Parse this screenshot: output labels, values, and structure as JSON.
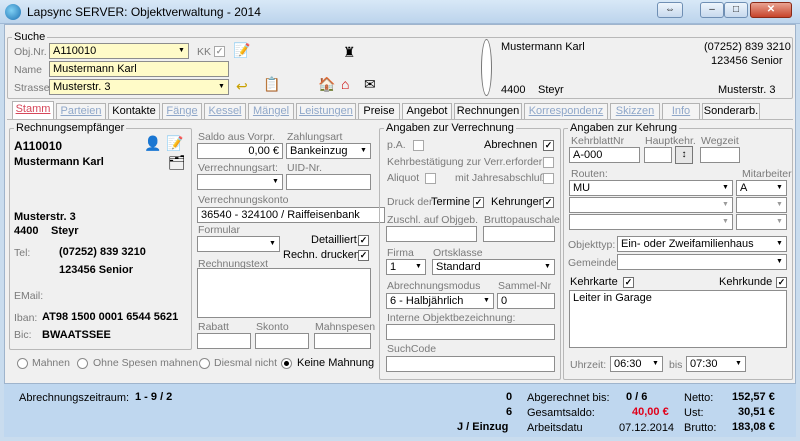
{
  "window": {
    "title": "Lapsync SERVER: Objektverwaltung - 2014",
    "btn_arrows": "⇔",
    "btn_min": "–",
    "btn_max": "□",
    "btn_close": "✕"
  },
  "suche": {
    "legend": "Suche",
    "objnr_label": "Obj.Nr.",
    "objnr": "A110010",
    "kk_label": "KK",
    "name_label": "Name",
    "name": "Mustermann Karl",
    "strasse_label": "Strasse",
    "strasse": "Musterstr. 3"
  },
  "address_card": {
    "name": "Mustermann Karl",
    "phone": "(07252) 839 3210",
    "phone2": "123456 Senior",
    "plz": "4400",
    "city": "Steyr",
    "street": "Musterstr. 3"
  },
  "tabs": [
    "Stamm",
    "Parteien",
    "Kontakte",
    "Fänge",
    "Kessel",
    "Mängel",
    "Leistungen",
    "Preise",
    "Angebot",
    "Rechnungen",
    "Korrespondenz",
    "Skizzen",
    "Info",
    "Sonderarb."
  ],
  "rechnung": {
    "legend": "Rechnungsempfänger",
    "objnr": "A110010",
    "name": "Mustermann Karl",
    "street": "Musterstr. 3",
    "plz": "4400",
    "city": "Steyr",
    "tel_label": "Tel:",
    "tel": "(07252) 839 3210",
    "tel2": "123456 Senior",
    "email_label": "EMail:",
    "iban_label": "Iban:",
    "iban": "AT98 1500 0001 6544 5621",
    "bic_label": "Bic:",
    "bic": "BWAATSSEE"
  },
  "mid": {
    "saldo_label": "Saldo aus Vorpr.",
    "saldo": "0,00 €",
    "zahlungsart_label": "Zahlungsart",
    "zahlungsart": "Bankeinzug",
    "verrechnungsart_label": "Verrechnungsart:",
    "uid_label": "UID-Nr.",
    "verrechnungskonto_label": "Verrechnungskonto",
    "verrechnungskonto": "36540 - 324100  / Raiffeisenbank",
    "formular_label": "Formular",
    "detailliert_label": "Detailliert",
    "rechn_drucken_label": "Rechn. drucken",
    "rechnungstext_label": "Rechnungstext",
    "rabatt_label": "Rabatt",
    "skonto_label": "Skonto",
    "mahnspesen_label": "Mahnspesen"
  },
  "mahnung": {
    "options": [
      "Mahnen",
      "Ohne Spesen mahnen",
      "Diesmal nicht",
      "Keine Mahnung"
    ],
    "selected": "Keine Mahnung"
  },
  "verrechnung": {
    "legend": "Angaben zur Verrechnung",
    "pa_label": "p.A.",
    "abrechnen_label": "Abrechnen",
    "kehrbest_label": "Kehrbestätigung zur Verr.erforderl.",
    "aliquot_label": "Aliquot",
    "jahresabschluss_label": "mit Jahresabschluß",
    "druck_label": "Druck der",
    "termine_label": "Termine",
    "kehrungen_label": "Kehrungen",
    "zuschl_label": "Zuschl. auf Objgeb.",
    "brutto_label": "Bruttopauschale",
    "firma_label": "Firma",
    "firma": "1",
    "ortsklasse_label": "Ortsklasse",
    "ortsklasse": "Standard",
    "abrmodus_label": "Abrechnungsmodus",
    "abrmodus": "6 - Halbjährlich",
    "sammel_label": "Sammel-Nr",
    "sammel": "0",
    "interne_label": "Interne Objektbezeichnung:",
    "suchcode_label": "SuchCode"
  },
  "kehrung": {
    "legend": "Angaben zur Kehrung",
    "kehrblatt_label": "KehrblattNr",
    "kehrblatt": "A-000",
    "hauptkehr_label": "Hauptkehr.",
    "wegzeit_label": "Wegzeit",
    "routen_label": "Routen:",
    "route1": "MU",
    "mitarbeiter_label": "Mitarbeiter",
    "mitarbeiter1": "A",
    "objekttyp_label": "Objekttyp:",
    "objekttyp": "Ein- oder Zweifamilienhaus",
    "gemeinde_label": "Gemeinde:",
    "kehrkarte_label": "Kehrkarte",
    "kehrkunde_label": "Kehrkunde",
    "notiz": "Leiter in Garage",
    "uhrzeit_label": "Uhrzeit:",
    "von": "06:30",
    "bis_label": "bis",
    "bis": "07:30"
  },
  "footer": {
    "zeitraum_label": "Abrechnungszeitraum:",
    "zeitraum": "1 - 9 / 2",
    "n1": "0",
    "n2": "6",
    "j_einzug": "J / Einzug",
    "abgerechnet_label": "Abgerechnet bis:",
    "abgerechnet": "0 / 6",
    "gesamtsaldo_label": "Gesamtsaldo:",
    "gesamtsaldo": "40,00 €",
    "arbeitsdatum_label": "Arbeitsdatu",
    "arbeitsdatum": "07.12.2014",
    "netto_label": "Netto:",
    "netto": "152,57 €",
    "ust_label": "Ust:",
    "ust": "30,51 €",
    "brutto_label": "Brutto:",
    "brutto": "183,08 €"
  },
  "colors": {
    "accent_red": "#e0001a",
    "titlebar": "#c9dcee",
    "field_yellow": "#fffbc8"
  }
}
